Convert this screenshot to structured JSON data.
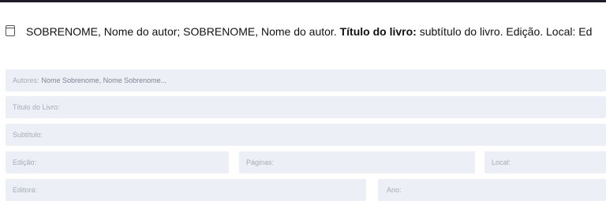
{
  "citation": {
    "icon": "book-icon",
    "prefix": "SOBRENOME, Nome do autor; SOBRENOME, Nome do autor. ",
    "title_bold": "Título do livro:",
    "suffix": " subtítulo do livro. Edição. Local: Ed"
  },
  "form": {
    "autores": {
      "label": "Autores:",
      "placeholder": "Nome Sobrenome, Nome Sobrenome..."
    },
    "titulo": {
      "label": "Título do Livro:"
    },
    "subtitulo": {
      "label": "Subtítulo:"
    },
    "edicao": {
      "label": "Edição:"
    },
    "paginas": {
      "label": "Páginas:"
    },
    "local": {
      "label": "Local:"
    },
    "editora": {
      "label": "Editora:"
    },
    "ano": {
      "label": "Ano:"
    }
  }
}
